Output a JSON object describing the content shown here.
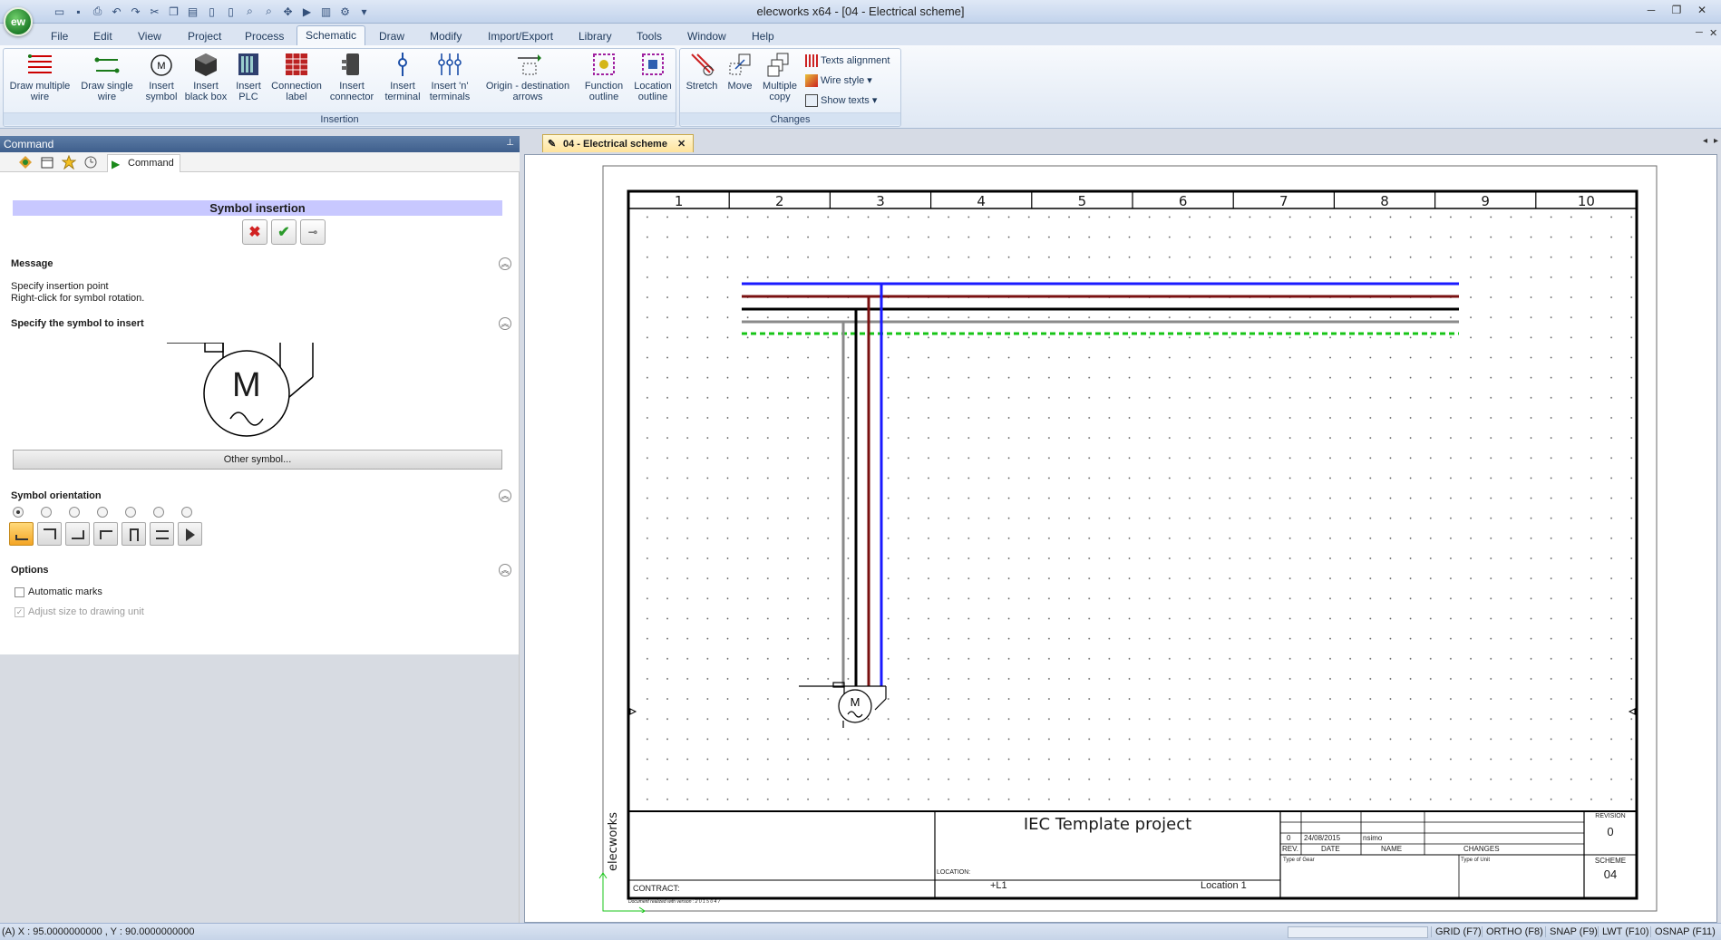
{
  "window": {
    "title": "elecworks x64 - [04 - Electrical scheme]",
    "app_badge": "ew"
  },
  "menu": [
    "File",
    "Edit",
    "View",
    "Project",
    "Process",
    "Schematic",
    "Draw",
    "Modify",
    "Import/Export",
    "Library",
    "Tools",
    "Window",
    "Help"
  ],
  "menu_active": "Schematic",
  "ribbon": {
    "insertion_label": "Insertion",
    "changes_label": "Changes",
    "buttons": {
      "draw_multiple_wire": "Draw multiple wire",
      "draw_single_wire": "Draw single wire",
      "insert_symbol": "Insert symbol",
      "insert_black_box": "Insert black box",
      "insert_plc": "Insert PLC",
      "connection_label": "Connection label",
      "insert_connector": "Insert connector",
      "insert_terminal": "Insert terminal",
      "insert_n_terminals": "Insert 'n' terminals",
      "origin_destination_arrows": "Origin - destination arrows",
      "function_outline": "Function outline",
      "location_outline": "Location outline",
      "stretch": "Stretch",
      "move": "Move",
      "multiple_copy": "Multiple copy",
      "texts_alignment": "Texts alignment",
      "wire_style": "Wire style",
      "show_texts": "Show texts"
    }
  },
  "command_panel": {
    "header": "Command",
    "tab_label": "Command",
    "title": "Symbol insertion",
    "message_section": "Message",
    "message_lines": [
      "Specify insertion point",
      "Right-click for symbol rotation."
    ],
    "symbol_section": "Specify the symbol to insert",
    "preview_symbol_letter": "M",
    "other_symbol": "Other symbol...",
    "orientation_section": "Symbol orientation",
    "options_section": "Options",
    "option_automatic_marks": "Automatic marks",
    "option_adjust_size": "Adjust size to drawing unit"
  },
  "document": {
    "tab": "04 - Electrical scheme",
    "columns": [
      "1",
      "2",
      "3",
      "4",
      "5",
      "6",
      "7",
      "8",
      "9",
      "10"
    ],
    "motor_letter": "M",
    "title_block": {
      "project_title": "IEC Template project",
      "brand": "elecworks",
      "contract_label": "CONTRACT:",
      "location_label": "LOCATION:",
      "location_code": "+L1",
      "location_name": "Location 1",
      "rev_value": "0",
      "date_value": "24/08/2015",
      "name_value": "nsimo",
      "rev_header": "REV.",
      "date_header": "DATE",
      "name_header": "NAME",
      "changes_header": "CHANGES",
      "type_of_gear": "Type of Gear",
      "type_of_unit": "Type of Unit",
      "revision_label": "REVISION",
      "revision_value": "0",
      "scheme_label": "SCHEME",
      "scheme_value": "04",
      "footer_note": "Document realized with version : 2 0 1 5 0 4 7"
    }
  },
  "status": {
    "coords": "(A) X : 95.0000000000 , Y : 90.0000000000",
    "toggles": [
      "GRID (F7)",
      "ORTHO (F8)",
      "SNAP (F9)",
      "LWT (F10)",
      "OSNAP (F11)"
    ]
  },
  "colors": {
    "wire_blue": "#1a1aff",
    "wire_brown": "#7a1010",
    "wire_black": "#000000",
    "wire_gray": "#8a8a8a",
    "wire_earth": "#18c418",
    "accent_orange": "#f4a524"
  }
}
